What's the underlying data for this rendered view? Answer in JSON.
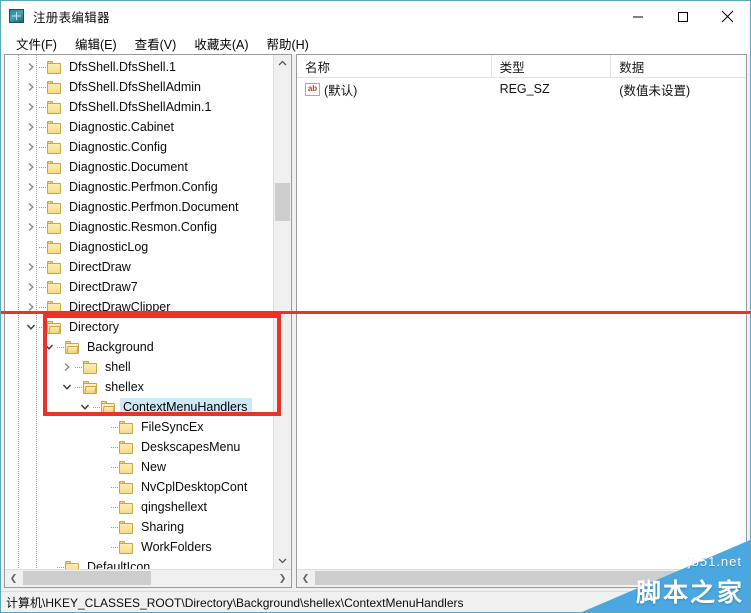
{
  "window": {
    "title": "注册表编辑器",
    "icon": "registry-editor-icon",
    "controls": {
      "minimize": "—",
      "maximize": "□",
      "close": "✕"
    }
  },
  "menubar": {
    "items": [
      {
        "label": "文件(F)",
        "name": "menu-file"
      },
      {
        "label": "编辑(E)",
        "name": "menu-edit"
      },
      {
        "label": "查看(V)",
        "name": "menu-view"
      },
      {
        "label": "收藏夹(A)",
        "name": "menu-favorites"
      },
      {
        "label": "帮助(H)",
        "name": "menu-help"
      }
    ]
  },
  "tree": {
    "items": [
      {
        "label": "DfsShell.DfsShell.1",
        "depth": 1,
        "state": "collapsed"
      },
      {
        "label": "DfsShell.DfsShellAdmin",
        "depth": 1,
        "state": "collapsed"
      },
      {
        "label": "DfsShell.DfsShellAdmin.1",
        "depth": 1,
        "state": "collapsed"
      },
      {
        "label": "Diagnostic.Cabinet",
        "depth": 1,
        "state": "collapsed"
      },
      {
        "label": "Diagnostic.Config",
        "depth": 1,
        "state": "collapsed"
      },
      {
        "label": "Diagnostic.Document",
        "depth": 1,
        "state": "collapsed"
      },
      {
        "label": "Diagnostic.Perfmon.Config",
        "depth": 1,
        "state": "collapsed"
      },
      {
        "label": "Diagnostic.Perfmon.Document",
        "depth": 1,
        "state": "collapsed"
      },
      {
        "label": "Diagnostic.Resmon.Config",
        "depth": 1,
        "state": "collapsed"
      },
      {
        "label": "DiagnosticLog",
        "depth": 1,
        "state": "leaf"
      },
      {
        "label": "DirectDraw",
        "depth": 1,
        "state": "collapsed"
      },
      {
        "label": "DirectDraw7",
        "depth": 1,
        "state": "collapsed"
      },
      {
        "label": "DirectDrawClipper",
        "depth": 1,
        "state": "collapsed"
      },
      {
        "label": "Directory",
        "depth": 1,
        "state": "expanded"
      },
      {
        "label": "Background",
        "depth": 2,
        "state": "expanded"
      },
      {
        "label": "shell",
        "depth": 3,
        "state": "collapsed"
      },
      {
        "label": "shellex",
        "depth": 3,
        "state": "expanded"
      },
      {
        "label": "ContextMenuHandlers",
        "depth": 4,
        "state": "expanded",
        "selected": true
      },
      {
        "label": "FileSyncEx",
        "depth": 5,
        "state": "leaf"
      },
      {
        "label": "DeskscapesMenu",
        "depth": 5,
        "state": "leaf"
      },
      {
        "label": "New",
        "depth": 5,
        "state": "leaf"
      },
      {
        "label": "NvCplDesktopCont",
        "depth": 5,
        "state": "leaf"
      },
      {
        "label": "qingshellext",
        "depth": 5,
        "state": "leaf"
      },
      {
        "label": "Sharing",
        "depth": 5,
        "state": "leaf"
      },
      {
        "label": "WorkFolders",
        "depth": 5,
        "state": "leaf"
      },
      {
        "label": "DefaultIcon",
        "depth": 2,
        "state": "leaf"
      }
    ]
  },
  "list": {
    "columns": [
      {
        "label": "名称",
        "name": "column-name"
      },
      {
        "label": "类型",
        "name": "column-type"
      },
      {
        "label": "数据",
        "name": "column-data"
      }
    ],
    "rows": [
      {
        "name": "(默认)",
        "type": "REG_SZ",
        "data": "(数值未设置)",
        "icon": "ab-string-icon"
      }
    ]
  },
  "statusbar": {
    "path": "计算机\\HKEY_CLASSES_ROOT\\Directory\\Background\\shellex\\ContextMenuHandlers"
  },
  "watermark": {
    "english": "jb51.net",
    "chinese": "脚本之家"
  },
  "annotation": {
    "color": "#e8322a"
  },
  "colors": {
    "selection": "#cde8f7",
    "titlebar_border": "#5aa8bd",
    "folder": "#f8da84",
    "watermark": "#4aa7e0"
  }
}
